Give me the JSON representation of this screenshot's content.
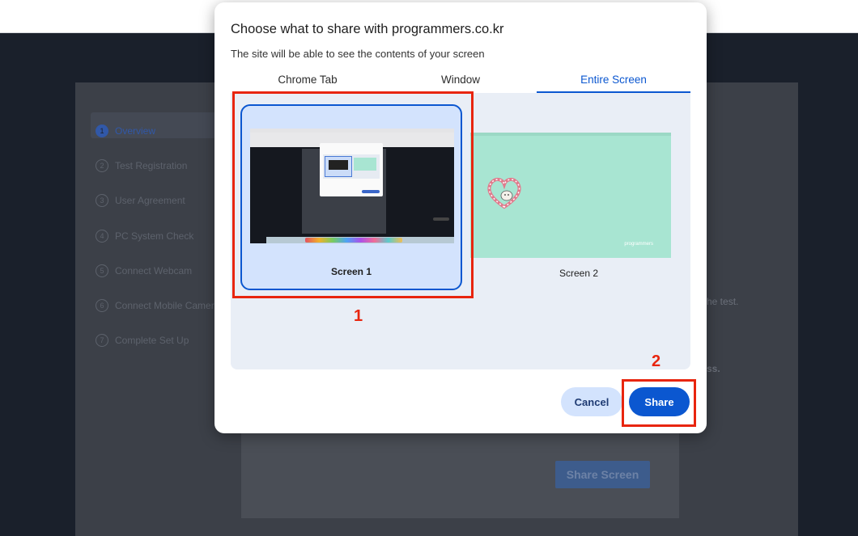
{
  "dialog": {
    "title": "Choose what to share with programmers.co.kr",
    "subtitle": "The site will be able to see the contents of your screen",
    "tabs": [
      {
        "label": "Chrome Tab",
        "active": false
      },
      {
        "label": "Window",
        "active": false
      },
      {
        "label": "Entire Screen",
        "active": true
      }
    ],
    "screens": [
      {
        "label": "Screen 1",
        "selected": true
      },
      {
        "label": "Screen 2",
        "selected": false
      }
    ],
    "cancel_label": "Cancel",
    "share_label": "Share"
  },
  "annotations": {
    "step1": "1",
    "step2": "2"
  },
  "background": {
    "steps": [
      {
        "num": "1",
        "label": "Overview"
      },
      {
        "num": "2",
        "label": "Test Registration"
      },
      {
        "num": "3",
        "label": "User Agreement"
      },
      {
        "num": "4",
        "label": "PC System Check"
      },
      {
        "num": "5",
        "label": "Connect Webcam"
      },
      {
        "num": "6",
        "label": "Connect Mobile Camera"
      },
      {
        "num": "7",
        "label": "Complete Set Up"
      }
    ],
    "right_text_1": "he test.",
    "right_text_2": "ss.",
    "share_screen_label": "Share Screen",
    "thumb2_logo": "programmers"
  },
  "colors": {
    "accent": "#0b57d0",
    "annotation": "#e8250e",
    "selected_tile": "#d3e3fd",
    "screen2_bg": "#a8e5d2"
  }
}
